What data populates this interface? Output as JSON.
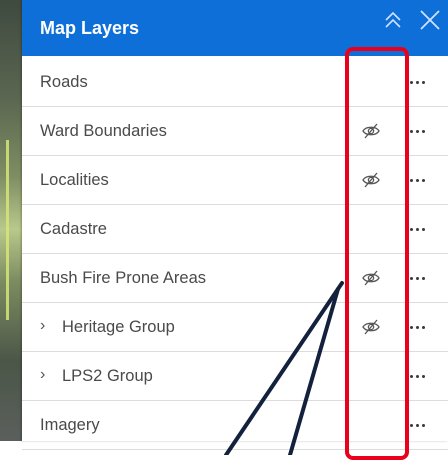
{
  "panel": {
    "title": "Map Layers",
    "collapse_icon": "double-chevron-up-icon",
    "close_icon": "close-icon"
  },
  "layers": [
    {
      "label": "Roads",
      "visibility_off": false,
      "group": false
    },
    {
      "label": "Ward Boundaries",
      "visibility_off": true,
      "group": false
    },
    {
      "label": "Localities",
      "visibility_off": true,
      "group": false
    },
    {
      "label": "Cadastre",
      "visibility_off": false,
      "group": false
    },
    {
      "label": "Bush Fire Prone Areas",
      "visibility_off": true,
      "group": false
    },
    {
      "label": "Heritage Group",
      "visibility_off": true,
      "group": true
    },
    {
      "label": "LPS2 Group",
      "visibility_off": false,
      "group": true
    },
    {
      "label": "Imagery",
      "visibility_off": false,
      "group": false
    }
  ],
  "icons": {
    "group_expand": "chevron-right-icon",
    "hidden": "eye-slash-icon",
    "options": "more-options-icon"
  },
  "annotation": {
    "highlight_color": "#e8001c",
    "pointer_color": "#14213d"
  },
  "colors": {
    "header": "#0f6fd8"
  }
}
